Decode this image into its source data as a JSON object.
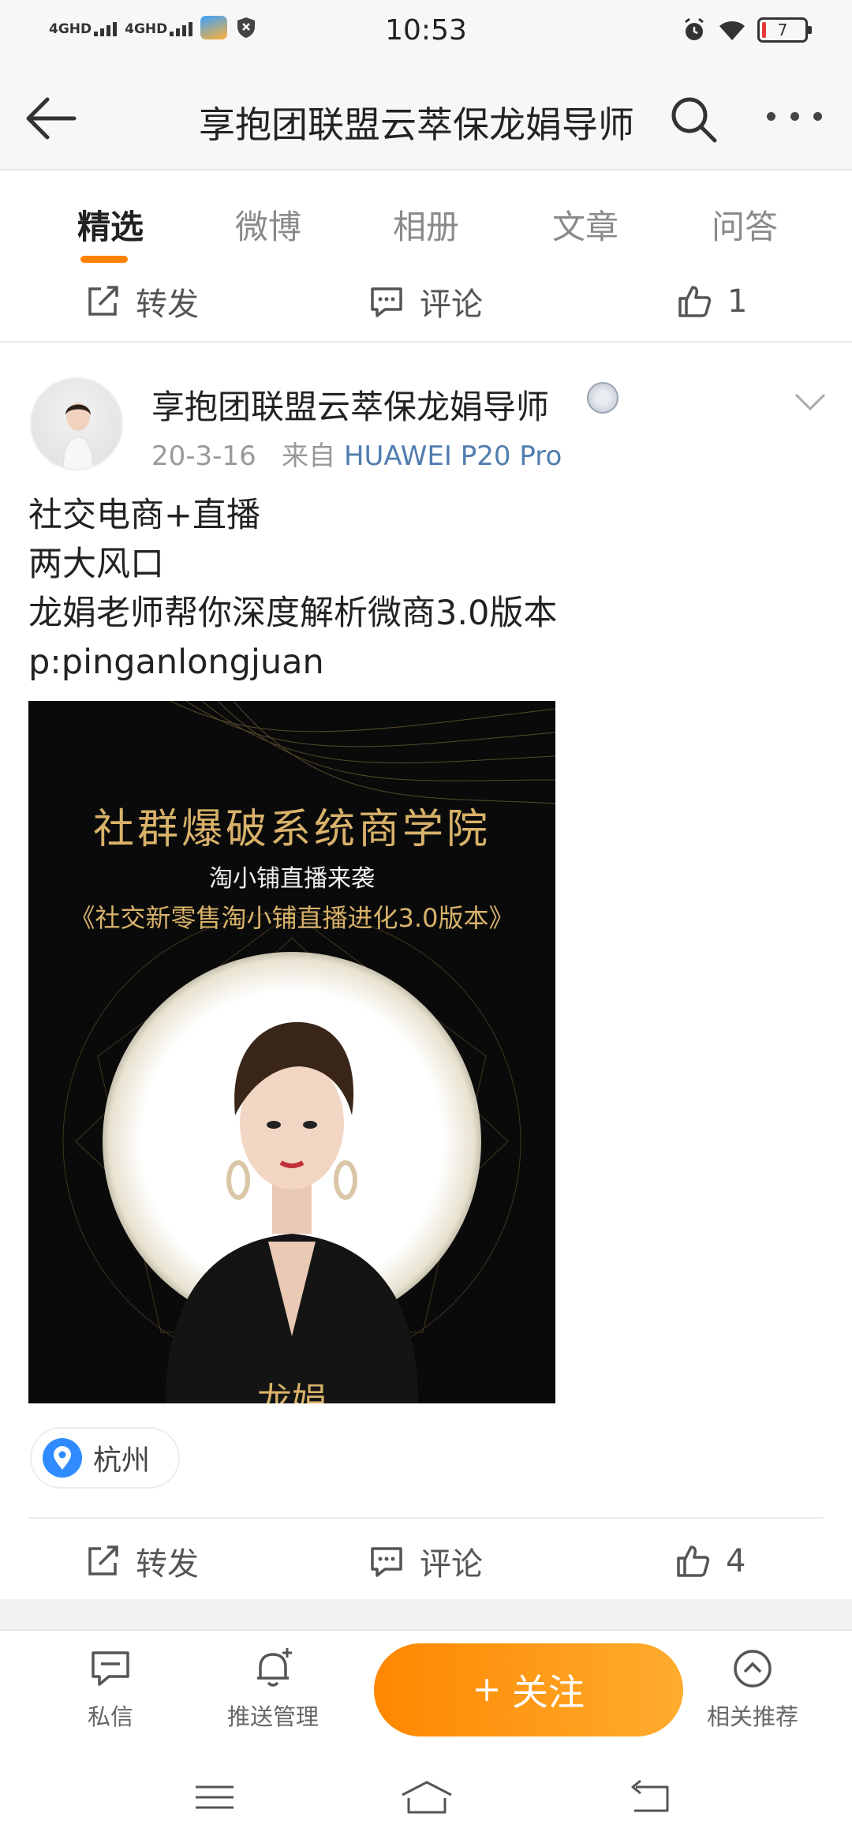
{
  "status_bar": {
    "network1": "4GHD",
    "network2": "4GHD",
    "time": "10:53",
    "battery": "7"
  },
  "header": {
    "title": "享抱团联盟云萃保龙娟导师",
    "icons": [
      "back-arrow-icon",
      "search-icon",
      "more-icon"
    ]
  },
  "tabs": [
    {
      "label": "精选",
      "active": true
    },
    {
      "label": "微博",
      "active": false
    },
    {
      "label": "相册",
      "active": false
    },
    {
      "label": "文章",
      "active": false
    },
    {
      "label": "问答",
      "active": false
    }
  ],
  "prev_post_actions": {
    "repost": "转发",
    "comment": "评论",
    "like_count": "1"
  },
  "post": {
    "author": "享抱团联盟云萃保龙娟导师",
    "date": "20-3-16",
    "source_prefix": "来自",
    "source": "HUAWEI P20 Pro",
    "text_lines": [
      "社交电商+直播",
      "两大风口",
      "龙娟老师帮你深度解析微商3.0版本",
      "p:pinganlongjuan"
    ],
    "image": {
      "title": "社群爆破系统商学院",
      "subtitle": "淘小铺直播来袭",
      "subtitle2": "《社交新零售淘小铺直播进化3.0版本》",
      "bottom_text": "龙娟"
    },
    "location": "杭州",
    "actions": {
      "repost": "转发",
      "comment": "评论",
      "like_count": "4"
    }
  },
  "bottom_bar": {
    "message": "私信",
    "push": "推送管理",
    "follow": "关注",
    "recommend": "相关推荐"
  },
  "colors": {
    "accent": "#ff8200",
    "link": "#507daf",
    "location_pin": "#2f8bff"
  }
}
